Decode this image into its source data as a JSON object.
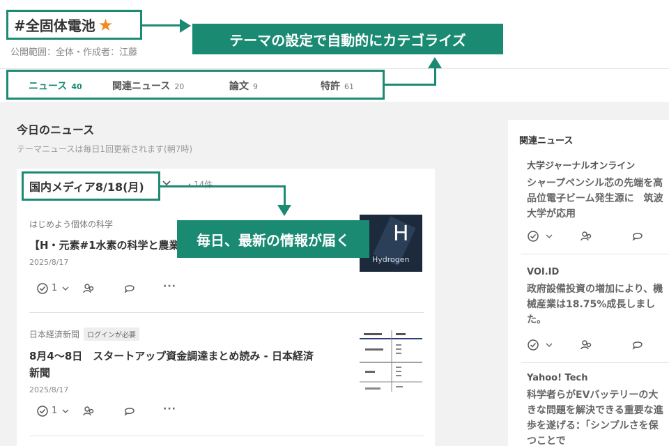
{
  "header": {
    "title": "#全固体電池",
    "star_icon": "★",
    "meta": "公開範囲：全体・作成者：江藤"
  },
  "tabs": [
    {
      "label": "ニュース",
      "count": "40",
      "active": true
    },
    {
      "label": "関連ニュース",
      "count": "20",
      "active": false
    },
    {
      "label": "論文",
      "count": "9",
      "active": false
    },
    {
      "label": "特許",
      "count": "61",
      "active": false
    }
  ],
  "callouts": {
    "auto_categorize": "テーマの設定で自動的にカテゴライズ",
    "daily_delivery": "毎日、最新の情報が届く"
  },
  "main": {
    "section_title": "今日のニュース",
    "section_sub": "テーマニュースは毎日1回更新されます(朝7時)",
    "media_label": "国内メディア8/18(月)",
    "media_count": "・14件",
    "articles": [
      {
        "source": "はじめよう個体の科学",
        "badge": "",
        "title": "【H・元素#1水素の科学と農業】",
        "date": "2025/8/17",
        "check_count": "1",
        "thumb_letter": "H",
        "thumb_caption": "Hydrogen"
      },
      {
        "source": "日本経済新聞",
        "badge": "ログインが必要",
        "title": "8月4〜8日　スタートアップ資金調達まとめ読み - 日本経済新聞",
        "date": "2025/8/17",
        "check_count": "1"
      }
    ]
  },
  "sidebar": {
    "title": "関連ニュース",
    "items": [
      {
        "source": "大学ジャーナルオンライン",
        "text": "シャープペンシル芯の先端を高品位電子ビーム発生源に　筑波大学が応用"
      },
      {
        "source": "VOI.ID",
        "text": "政府設備投資の増加により、機械産業は18.75%成長しました。"
      },
      {
        "source": "Yahoo! Tech",
        "text": "科学者らがEVバッテリーの大きな問題を解決できる重要な進歩を遂げる：「シンプルさを保つことで"
      }
    ]
  },
  "colors": {
    "accent": "#1a8a72",
    "star": "#f08a24"
  }
}
